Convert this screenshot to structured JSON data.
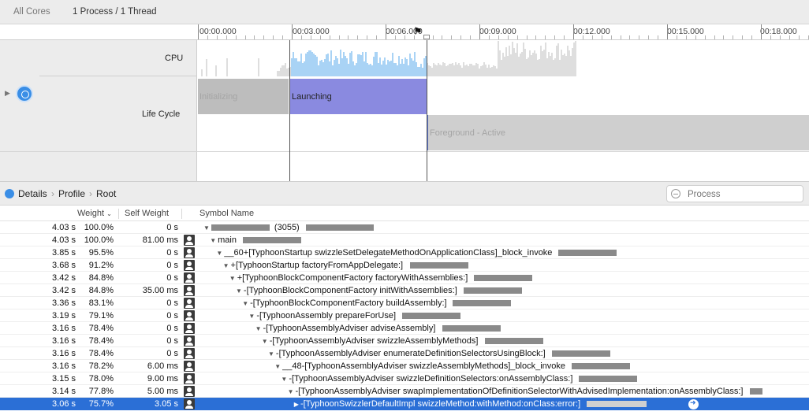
{
  "scope": {
    "cores": "All Cores",
    "process": "1 Process / 1 Thread"
  },
  "ruler": {
    "labels": [
      "00:00.000",
      "00:03.000",
      "00:06.000",
      "00:09.000",
      "00:12.000",
      "00:15.000",
      "00:18.000"
    ]
  },
  "tracks": {
    "cpu_label": "CPU",
    "lifecycle_label": "Life Cycle",
    "phases": {
      "initializing": "Initializing",
      "launching": "Launching",
      "foreground": "Foreground - Active"
    }
  },
  "details": {
    "breadcrumb": [
      "Details",
      "Profile",
      "Root"
    ],
    "search_placeholder": "Process"
  },
  "columns": {
    "weight": "Weight",
    "self_weight": "Self Weight",
    "symbol": "Symbol Name"
  },
  "rows": [
    {
      "w": "4.03 s",
      "p": "100.0%",
      "sw": "0 s",
      "sym": "(3055)",
      "icon": false
    },
    {
      "w": "4.03 s",
      "p": "100.0%",
      "sw": "81.00 ms",
      "sym": "main",
      "icon": true
    },
    {
      "w": "3.85 s",
      "p": "95.5%",
      "sw": "0 s",
      "sym": "__60+[TyphoonStartup swizzleSetDelegateMethodOnApplicationClass]_block_invoke",
      "icon": true
    },
    {
      "w": "3.68 s",
      "p": "91.2%",
      "sw": "0 s",
      "sym": "+[TyphoonStartup factoryFromAppDelegate:]",
      "icon": true
    },
    {
      "w": "3.42 s",
      "p": "84.8%",
      "sw": "0 s",
      "sym": "+[TyphoonBlockComponentFactory factoryWithAssemblies:]",
      "icon": true
    },
    {
      "w": "3.42 s",
      "p": "84.8%",
      "sw": "35.00 ms",
      "sym": "-[TyphoonBlockComponentFactory initWithAssemblies:]",
      "icon": true
    },
    {
      "w": "3.36 s",
      "p": "83.1%",
      "sw": "0 s",
      "sym": "-[TyphoonBlockComponentFactory buildAssembly:]",
      "icon": true
    },
    {
      "w": "3.19 s",
      "p": "79.1%",
      "sw": "0 s",
      "sym": "-[TyphoonAssembly prepareForUse]",
      "icon": true
    },
    {
      "w": "3.16 s",
      "p": "78.4%",
      "sw": "0 s",
      "sym": "-[TyphoonAssemblyAdviser adviseAssembly]",
      "icon": true
    },
    {
      "w": "3.16 s",
      "p": "78.4%",
      "sw": "0 s",
      "sym": "-[TyphoonAssemblyAdviser swizzleAssemblyMethods]",
      "icon": true
    },
    {
      "w": "3.16 s",
      "p": "78.4%",
      "sw": "0 s",
      "sym": "-[TyphoonAssemblyAdviser enumerateDefinitionSelectorsUsingBlock:]",
      "icon": true
    },
    {
      "w": "3.16 s",
      "p": "78.2%",
      "sw": "6.00 ms",
      "sym": "__48-[TyphoonAssemblyAdviser swizzleAssemblyMethods]_block_invoke",
      "icon": true
    },
    {
      "w": "3.15 s",
      "p": "78.0%",
      "sw": "9.00 ms",
      "sym": "-[TyphoonAssemblyAdviser swizzleDefinitionSelectors:onAssemblyClass:]",
      "icon": true
    },
    {
      "w": "3.14 s",
      "p": "77.8%",
      "sw": "5.00 ms",
      "sym": "-[TyphoonAssemblyAdviser swapImplementationOfDefinitionSelectorWithAdvisedImplementation:onAssemblyClass:]",
      "icon": true
    },
    {
      "w": "3.06 s",
      "p": "75.7%",
      "sw": "3.05 s",
      "sym": "-[TyphoonSwizzlerDefaultImpl swizzleMethod:withMethod:onClass:error:]",
      "icon": true
    }
  ]
}
